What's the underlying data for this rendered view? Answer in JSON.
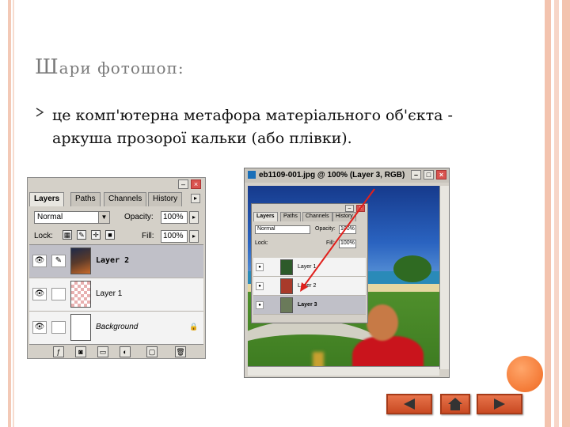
{
  "slide": {
    "title_first_letter": "Ш",
    "title_rest": "ари фотошоп:",
    "bullet_text": "це комп'ютерна метафора матеріального об'єкта - аркуша прозорої кальки (або плівки)."
  },
  "layers_panel": {
    "tabs": [
      "Layers",
      "Paths",
      "Channels",
      "History"
    ],
    "blend_mode": "Normal",
    "opacity_label": "Opacity:",
    "opacity_value": "100%",
    "lock_label": "Lock:",
    "fill_label": "Fill:",
    "fill_value": "100%",
    "layers": [
      {
        "name": "Layer 2"
      },
      {
        "name": "Layer 1"
      },
      {
        "name": "Background"
      }
    ]
  },
  "document_window": {
    "title": "eb1109-001.jpg @ 100% (Layer 3, RGB)",
    "mini_panel": {
      "tabs": [
        "Layers",
        "Paths",
        "Channels",
        "History"
      ],
      "blend_mode": "Normal",
      "opacity_label": "Opacity:",
      "opacity_value": "100%",
      "lock_label": "Lock:",
      "fill_label": "Fill:",
      "fill_value": "100%",
      "layers": [
        {
          "name": "Layer 1"
        },
        {
          "name": "Layer 2"
        },
        {
          "name": "Layer 3"
        }
      ]
    }
  },
  "navigation": {
    "icons": [
      "arrow-left-icon",
      "home-icon",
      "arrow-right-icon"
    ]
  },
  "colors": {
    "accent_orange": "#f47a36",
    "nav_button": "#d6572d",
    "border_peach": "#f3c3ae"
  }
}
